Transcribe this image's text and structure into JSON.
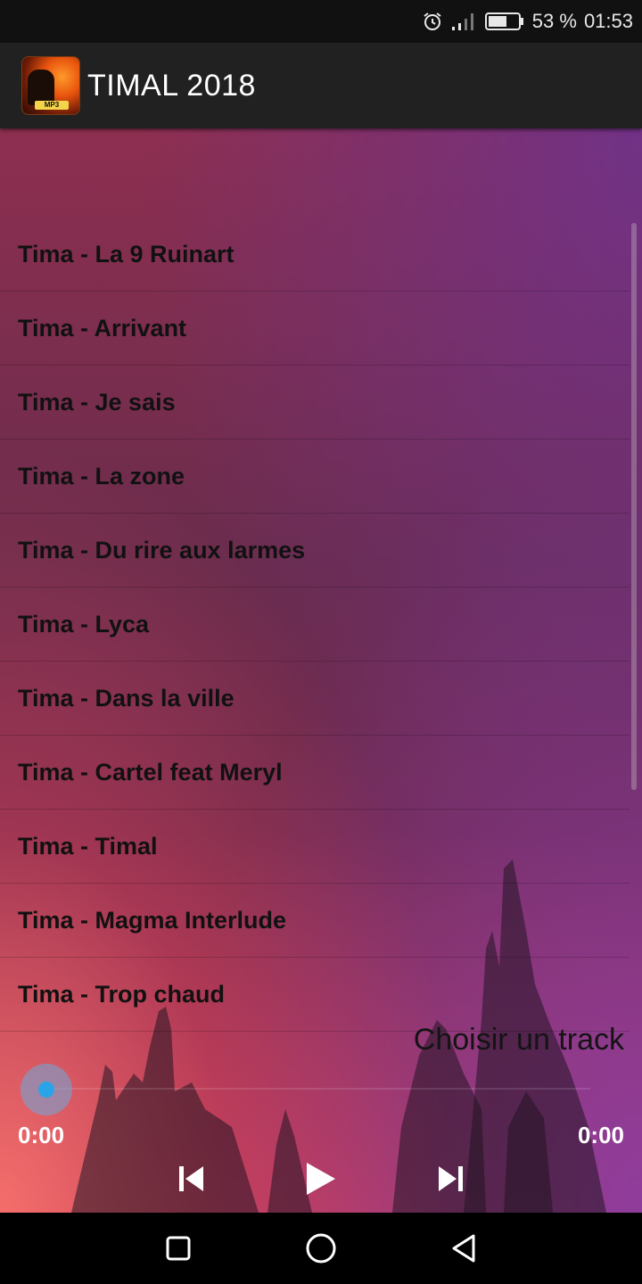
{
  "status_bar": {
    "battery": "53 %",
    "time": "01:53",
    "icons": [
      "alarm-icon",
      "signal-icon",
      "battery-icon"
    ]
  },
  "app_bar": {
    "logo_text": "MP3",
    "title": "TIMAL 2018"
  },
  "tracks": [
    "Tima - La 9 Ruinart",
    "Tima - Arrivant",
    "Tima - Je sais",
    "Tima - La zone",
    "Tima - Du rire aux larmes",
    "Tima - Lyca",
    "Tima - Dans la ville",
    "Tima - Cartel feat Meryl",
    "Tima - Timal",
    "Tima - Magma Interlude",
    "Tima - Trop chaud"
  ],
  "player": {
    "now_playing": "Choisir un track",
    "elapsed": "0:00",
    "duration": "0:00",
    "progress": 0,
    "controls": [
      "skip-previous-icon",
      "play-icon",
      "skip-next-icon"
    ],
    "accent_color": "#2aa4e8"
  },
  "nav_bar": {
    "buttons": [
      "recents-square-icon",
      "home-circle-icon",
      "back-triangle-icon"
    ]
  }
}
